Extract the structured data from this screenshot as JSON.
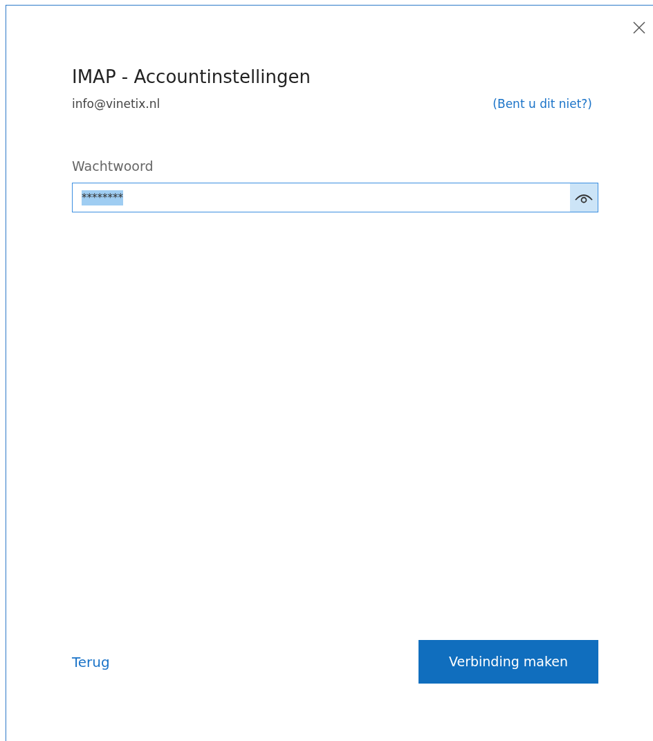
{
  "dialog": {
    "title": "IMAP - Accountinstellingen",
    "account": "info@vinetix.nl",
    "not_you_link": "(Bent u dit niet?)"
  },
  "password": {
    "label": "Wachtwoord",
    "value": "********",
    "value_selected": true
  },
  "buttons": {
    "back": "Terug",
    "connect": "Verbinding maken"
  }
}
